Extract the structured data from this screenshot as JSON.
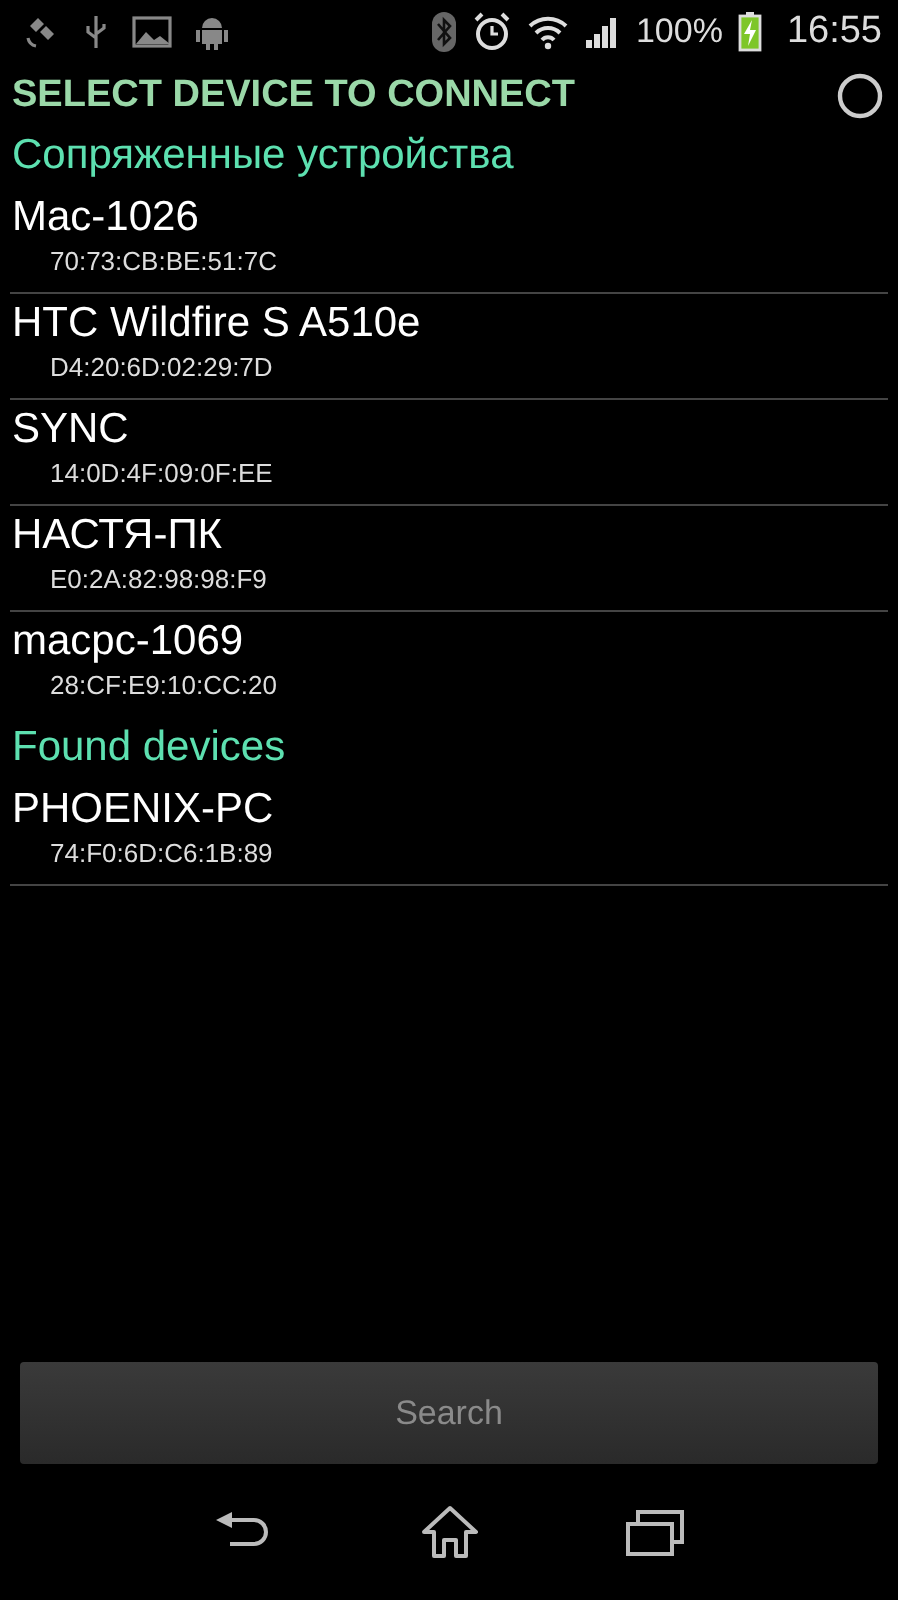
{
  "status_bar": {
    "battery": "100%",
    "time": "16:55"
  },
  "title": "SELECT DEVICE TO CONNECT",
  "busy": true,
  "sections": [
    {
      "title": "Сопряженные устройства",
      "devices": [
        {
          "name": "Mac-1026",
          "address": "70:73:CB:BE:51:7C"
        },
        {
          "name": "HTC Wildfire S A510e",
          "address": "D4:20:6D:02:29:7D"
        },
        {
          "name": "SYNC",
          "address": "14:0D:4F:09:0F:EE"
        },
        {
          "name": "НАСТЯ-ПК",
          "address": "E0:2A:82:98:98:F9"
        },
        {
          "name": "macpc-1069",
          "address": "28:CF:E9:10:CC:20"
        }
      ]
    },
    {
      "title": "Found devices",
      "devices": [
        {
          "name": "PHOENIX-PC",
          "address": "74:F0:6D:C6:1B:89"
        }
      ]
    }
  ],
  "search_button": {
    "label": "Search",
    "disabled": true
  }
}
